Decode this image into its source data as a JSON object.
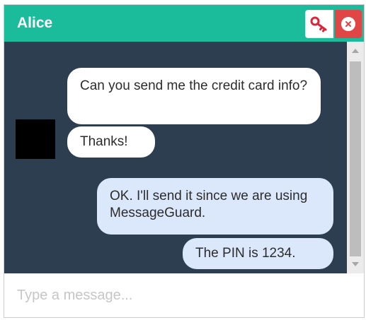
{
  "header": {
    "title": "Alice",
    "key_icon": "key-icon",
    "close_icon": "close-icon",
    "bg_color": "#1abc9c"
  },
  "conversation": {
    "bg_color": "#2c3e50",
    "incoming_color": "#ffffff",
    "outgoing_color": "#dbe8fb",
    "messages": [
      {
        "direction": "incoming",
        "text": "Can you send me the credit card info?"
      },
      {
        "direction": "incoming",
        "text": "Thanks!"
      },
      {
        "direction": "outgoing",
        "text": "OK. I'll send it since we are using MessageGuard."
      },
      {
        "direction": "outgoing",
        "text": "The PIN is 1234."
      }
    ]
  },
  "composer": {
    "placeholder": "Type a message..."
  }
}
